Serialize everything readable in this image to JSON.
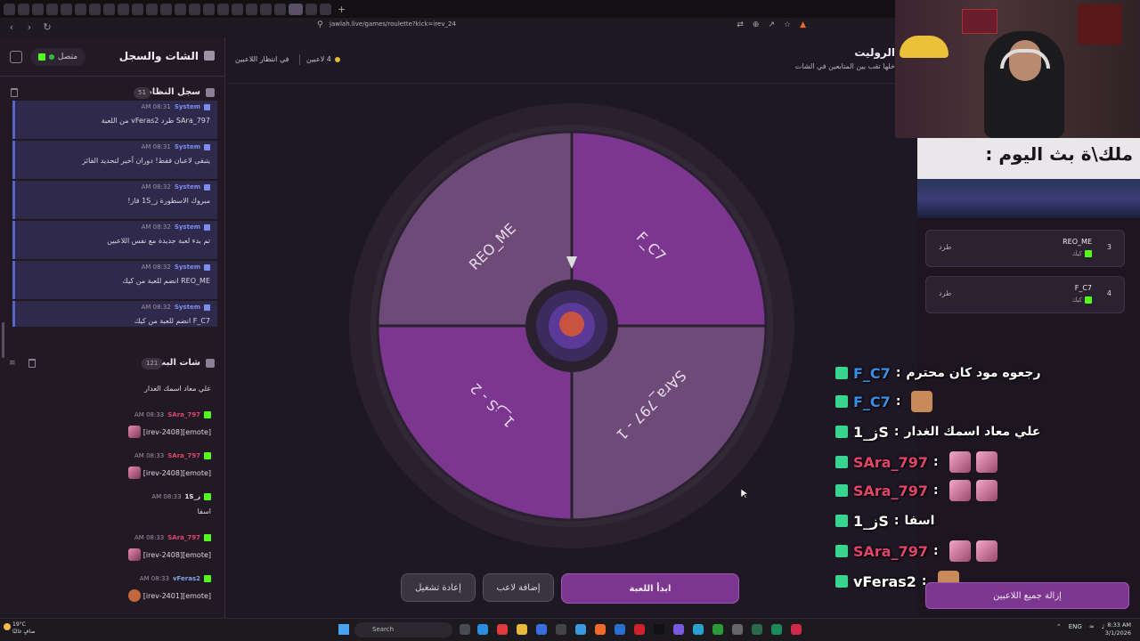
{
  "browser": {
    "url": "jawlah.live/games/roulette?kick=irev_24",
    "new_tab": "+"
  },
  "left_panel": {
    "title": "الشات والسجل",
    "status": "متصل",
    "system_log": {
      "title": "سجل النظام",
      "count": "51",
      "items": [
        {
          "sender": "System",
          "time": "AM 08:31",
          "text": "SAra_797 طرد vFeras2 من اللعبة"
        },
        {
          "sender": "System",
          "time": "AM 08:31",
          "text": "يتبقى لاعبان فقط! دوران أخير لتحديد الفائز"
        },
        {
          "sender": "System",
          "time": "AM 08:32",
          "text": "مبروك الاسطورة ز_1S فاز!"
        },
        {
          "sender": "System",
          "time": "AM 08:32",
          "text": "تم بدء لعبة جديدة مع نفس اللاعبين"
        },
        {
          "sender": "System",
          "time": "AM 08:32",
          "text": "REO_ME انضم للعبة من كيك"
        },
        {
          "sender": "System",
          "time": "AM 08:32",
          "text": "F_C7 انضم للعبة من كيك"
        }
      ]
    },
    "stream_chat": {
      "title": "شات البث",
      "count": "121",
      "partial_top": "علي معاد اسمك الغدار",
      "items": [
        {
          "user": "SAra_797",
          "user_color": "#e0446b",
          "time": "AM 08:33",
          "text": "[emote][irev-2408]",
          "emote": "irev-2408",
          "emote2": "irev-2408"
        },
        {
          "user": "SAra_797",
          "user_color": "#e0446b",
          "time": "AM 08:33",
          "text": "[emote][irev-2408]",
          "emote": "irev-2408"
        },
        {
          "user": "ز_1S",
          "user_color": "#f1ecf3",
          "time": "AM 08:33",
          "text": "اسفا"
        },
        {
          "user": "SAra_797",
          "user_color": "#e0446b",
          "time": "AM 08:33",
          "text": "[emote][irev-2408]",
          "emote": "irev-2408",
          "emote2": "irev-2408"
        },
        {
          "user": "vFeras2",
          "user_color": "#7fa3e6",
          "time": "AM 08:33",
          "text": "[emote][irev-2401]",
          "emote": "irev-2401"
        }
      ]
    }
  },
  "main": {
    "title": "الروليت",
    "subtitle": "خلها تقب بين المتابعين في الشات",
    "players": "4 لاعبين",
    "waiting": "في انتظار اللاعبين",
    "wheel": {
      "segments": [
        {
          "label": "F_C7",
          "color": "#7d3690"
        },
        {
          "label": "SAra_797 - 1",
          "color": "#6e4a79"
        },
        {
          "label": "ز_1S - 2",
          "color": "#7d3690"
        },
        {
          "label": "REO_ME",
          "color": "#6e4a79"
        }
      ]
    },
    "buttons": {
      "start": "ابدأ اللعبة",
      "add_player": "إضافة لاعب",
      "restart": "إعادة تشغيل"
    }
  },
  "right_panel": {
    "banner": "ملك\\ة بث اليوم :",
    "players": [
      {
        "num": "3",
        "name": "REO_ME",
        "source": "كيك",
        "action": "طرد"
      },
      {
        "num": "4",
        "name": "F_C7",
        "source": "كيك",
        "action": "طرد"
      }
    ],
    "remove_all": "إزالة جميع اللاعبين"
  },
  "overlay_chat": [
    {
      "user": "F_C7",
      "color": "#3b8ee6",
      "msg": "رجعوه مود كان محترم"
    },
    {
      "user": "F_C7",
      "color": "#3b8ee6",
      "msg": ""
    },
    {
      "user": "ز_1S",
      "color": "#ffffff",
      "msg": "علي معاد اسمك الغدار"
    },
    {
      "user": "SAra_797",
      "color": "#e0446b",
      "msg": ""
    },
    {
      "user": "SAra_797",
      "color": "#e0446b",
      "msg": ""
    },
    {
      "user": "ز_1S",
      "color": "#ffffff",
      "msg": "اسفا"
    },
    {
      "user": "SAra_797",
      "color": "#e0446b",
      "msg": ""
    },
    {
      "user": "vFeras2",
      "color": "#ffffff",
      "msg": ""
    }
  ],
  "taskbar": {
    "weather_temp": "19°C",
    "weather_desc": "صافٍ غالبًا",
    "search": "Search",
    "lang": "ENG",
    "time": "8:33 AM",
    "date": "3/1/2026"
  }
}
